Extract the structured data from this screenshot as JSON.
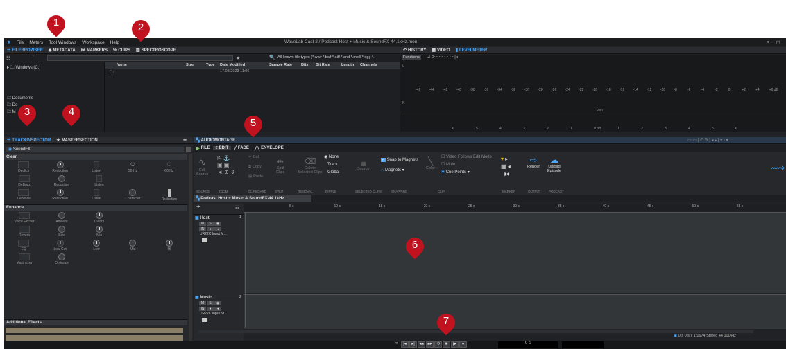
{
  "menu": {
    "items": [
      "File",
      "Meters",
      "Tool Windows",
      "Workspace",
      "Help"
    ],
    "title": "WaveLab Cast 2 / Podcast Host + Music & SoundFX 44.1kHz.mon"
  },
  "top_tabs": {
    "filebrowser": "FILEBROWSER",
    "metadata": "METADATA",
    "markers": "MARKERS",
    "clips": "CLIPS",
    "spectroscope": "SPECTROSCOPE"
  },
  "browser": {
    "folder_tree": "Windows (C:)",
    "filter": "All known file types (*.wav *.bwf *.aiff *.and *.mp3 *.ogg *.",
    "columns": [
      "Name",
      "Size",
      "Type",
      "Date Modified",
      "Sample Rate",
      "Bits",
      "Bit Rate",
      "Length",
      "Channels"
    ],
    "row_date": "17.03.2023 11:06",
    "places": [
      "Documents",
      "De",
      "M"
    ]
  },
  "meter": {
    "tabs": {
      "history": "HISTORY",
      "video": "VIDEO",
      "levelmeter": "LEVELMETER"
    },
    "functions": "Functions",
    "scale": [
      "-46",
      "-44",
      "-42",
      "-40",
      "-38",
      "-36",
      "-34",
      "-32",
      "-30",
      "-28",
      "-26",
      "-24",
      "-22",
      "-20",
      "-18",
      "-16",
      "-14",
      "-12",
      "-10",
      "-8",
      "-6",
      "-4",
      "-2",
      "0",
      "+2",
      "+4",
      "+6 dB"
    ],
    "pan": "Pan",
    "bottom_scale": [
      "6",
      "5",
      "4",
      "3",
      "2",
      "1",
      "0 dB",
      "1",
      "2",
      "3",
      "4",
      "5",
      "6"
    ],
    "L": "L",
    "R": "R"
  },
  "inspector": {
    "tab_track": "TRACKINSPECTOR",
    "tab_master": "MASTERSECTION",
    "track_name": "SoundFX",
    "sections": {
      "clean": "Clean",
      "enhance": "Enhance",
      "additional": "Additional Effects"
    },
    "clean_rows": [
      [
        "Declick",
        "Reduction",
        "Listen",
        "50 Hz",
        "60 Hz"
      ],
      [
        "DeBuzz",
        "Reduction",
        "Listen"
      ],
      [
        "DeNoise",
        "Reduction",
        "Listen",
        "Character",
        "Reduction"
      ]
    ],
    "enhance_rows": [
      [
        "Voice Exciter",
        "Amount",
        "Clarity"
      ],
      [
        "Reverb",
        "Size",
        "Mix"
      ],
      [
        "EQ",
        "Low Cut",
        "Low",
        "Mid",
        "Hi"
      ],
      [
        "Maximizer",
        "Optimize"
      ]
    ]
  },
  "montage": {
    "title": "AUDIOMONTAGE",
    "tabs": {
      "file": "FILE",
      "edit": "EDIT",
      "fade": "FADE",
      "envelope": "ENVELOPE"
    },
    "ribbon": {
      "edit": "Edit",
      "source": "Source",
      "cut": "Cut",
      "copy": "Copy",
      "paste": "Paste",
      "split": "Split",
      "clips": "Clips",
      "delete": "Delete",
      "selected": "Selected Clips",
      "none": "None",
      "trk": "Track",
      "global": "Global",
      "source2": "Source",
      "snap": "Snap to Magnets",
      "magnets": "Magnets",
      "color": "Color",
      "vfe": "Video Follows Edit Mode",
      "mute": "Mute",
      "cuepoints": "Cue Points",
      "render": "Render",
      "upload": "Upload",
      "episode": "Episode"
    },
    "groups": [
      "SOURCE",
      "ZOOM",
      "CLIPBOARD",
      "SPLIT",
      "REMOVAL",
      "RIPPLE",
      "SELECTED CLIPS",
      "SNAPPING",
      "CLIP",
      "MARKER",
      "OUTPUT",
      "PODCAST"
    ],
    "doc_tab": "Podcast Host + Music & SoundFX 44.1kHz",
    "ruler": [
      "5 s",
      "10 s",
      "15 s",
      "20 s",
      "25 s",
      "30 s",
      "35 s",
      "40 s",
      "45 s",
      "50 s",
      "55 s"
    ],
    "tracks": [
      {
        "name": "Host",
        "num": "1",
        "input": "UR22C Input M..."
      },
      {
        "name": "Music",
        "num": "2",
        "input": "UR22C Input St..."
      }
    ],
    "status": "0 s  0 s  x 1:1674  Stereo 44 100 Hz",
    "time": "0 s"
  },
  "callouts": [
    "1",
    "2",
    "3",
    "4",
    "5",
    "6",
    "7"
  ],
  "colors": {
    "accent": "#4aa8ff",
    "marker": "#c1121f",
    "bg": "#202225"
  }
}
